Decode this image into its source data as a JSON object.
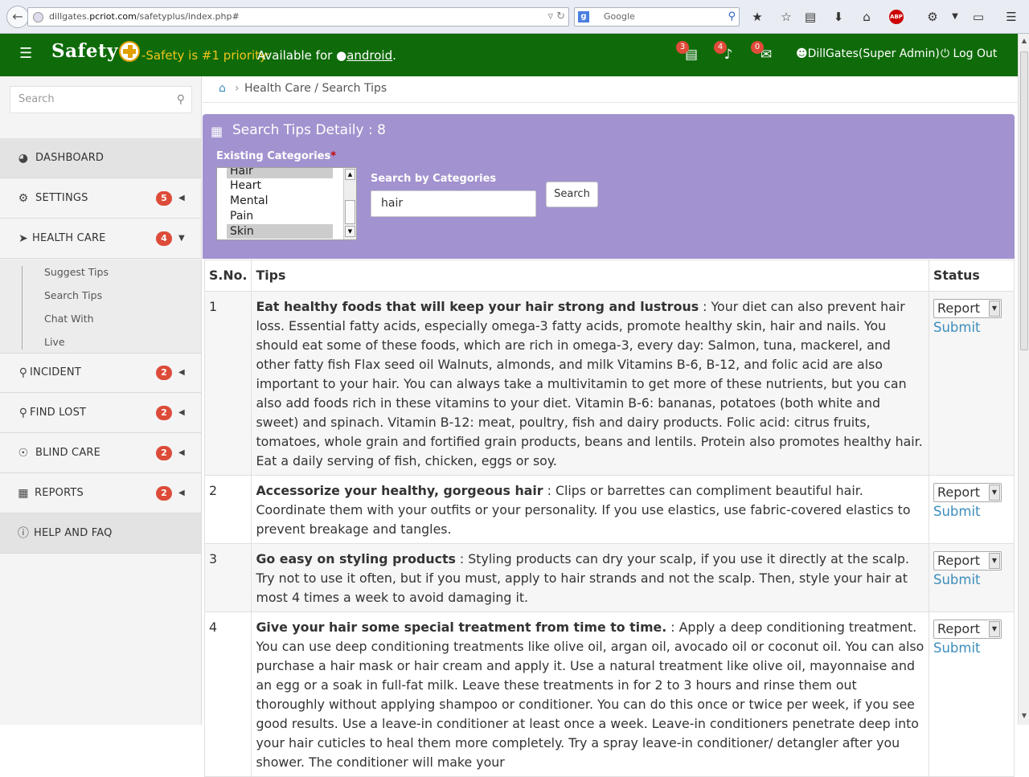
{
  "browser": {
    "url_prefix": "dillgates.",
    "url_domain": "pcriot.com",
    "url_rest": "/safetyplus/index.php#",
    "search_engine_placeholder": "Google"
  },
  "header": {
    "brand": "Safety",
    "slogan": "-Safety is #1 priority:",
    "available_text": "Available for",
    "android_link": "android",
    "period": ".",
    "notif_tasks_count": "3",
    "notif_bell_count": "4",
    "notif_mail_count": "0",
    "user": "DillGates(Super Admin)",
    "logout": "Log Out"
  },
  "sidebar": {
    "search_placeholder": "Search",
    "items": [
      {
        "label": "DASHBOARD",
        "icon": "dashboard-icon",
        "badge": ""
      },
      {
        "label": "SETTINGS",
        "icon": "cogs-icon",
        "badge": "5"
      },
      {
        "label": "HEALTH CARE",
        "icon": "location-arrow-icon",
        "badge": "4"
      },
      {
        "label": "INCIDENT",
        "icon": "map-marker-icon",
        "badge": "2"
      },
      {
        "label": "FIND LOST",
        "icon": "map-marker-icon",
        "badge": "2"
      },
      {
        "label": "BLIND CARE",
        "icon": "eye-slash-icon",
        "badge": "2"
      },
      {
        "label": "REPORTS",
        "icon": "table-icon",
        "badge": "2"
      },
      {
        "label": "HELP AND FAQ",
        "icon": "info-icon",
        "badge": ""
      }
    ],
    "health_care_sub": [
      "Suggest Tips",
      "Search Tips",
      "Chat With",
      "Live"
    ]
  },
  "breadcrumb": {
    "text": "Health Care / Search Tips"
  },
  "panel": {
    "title": "Search Tips Detaily : 8",
    "existing_categories_label": "Existing Categories",
    "required_mark": "*",
    "categories_visible": [
      "Hair",
      "Heart",
      "Mental",
      "Pain",
      "Skin"
    ],
    "selected_categories": [
      "Hair",
      "Skin"
    ],
    "search_by_label": "Search by Categories",
    "search_value": "hair",
    "search_button": "Search"
  },
  "table": {
    "headers": {
      "sno": "S.No.",
      "tips": "Tips",
      "status": "Status"
    },
    "status_option": "Report",
    "submit_label": "Submit",
    "rows": [
      {
        "sno": "1",
        "title": "Eat healthy foods that will keep your hair strong and lustrous",
        "body": " : Your diet can also prevent hair loss. Essential fatty acids, especially omega-3 fatty acids, promote healthy skin, hair and nails. You should eat some of these foods, which are rich in omega-3, every day: Salmon, tuna, mackerel, and other fatty fish Flax seed oil Walnuts, almonds, and milk Vitamins B-6, B-12, and folic acid are also important to your hair. You can always take a multivitamin to get more of these nutrients, but you can also add foods rich in these vitamins to your diet. Vitamin B-6: bananas, potatoes (both white and sweet) and spinach. Vitamin B-12: meat, poultry, fish and dairy products. Folic acid: citrus fruits, tomatoes, whole grain and fortified grain products, beans and lentils. Protein also promotes healthy hair. Eat a daily serving of fish, chicken, eggs or soy."
      },
      {
        "sno": "2",
        "title": "Accessorize your healthy, gorgeous hair",
        "body": " : Clips or barrettes can compliment beautiful hair. Coordinate them with your outfits or your personality. If you use elastics, use fabric-covered elastics to prevent breakage and tangles."
      },
      {
        "sno": "3",
        "title": "Go easy on styling products",
        "body": " : Styling products can dry your scalp, if you use it directly at the scalp. Try not to use it often, but if you must, apply to hair strands and not the scalp. Then, style your hair at most 4 times a week to avoid damaging it."
      },
      {
        "sno": "4",
        "title": "Give your hair some special treatment from time to time.",
        "body": " : Apply a deep conditioning treatment. You can use deep conditioning treatments like olive oil, argan oil, avocado oil or coconut oil. You can also purchase a hair mask or hair cream and apply it. Use a natural treatment like olive oil, mayonnaise and an egg or a soak in full-fat milk. Leave these treatments in for 2 to 3 hours and rinse them out thoroughly without applying shampoo or conditioner. You can do this once or twice per week, if you see good results. Use a leave-in conditioner at least once a week. Leave-in conditioners penetrate deep into your hair cuticles to heal them more completely. Try a spray leave-in conditioner/ detangler after you shower. The conditioner will make your"
      }
    ]
  }
}
